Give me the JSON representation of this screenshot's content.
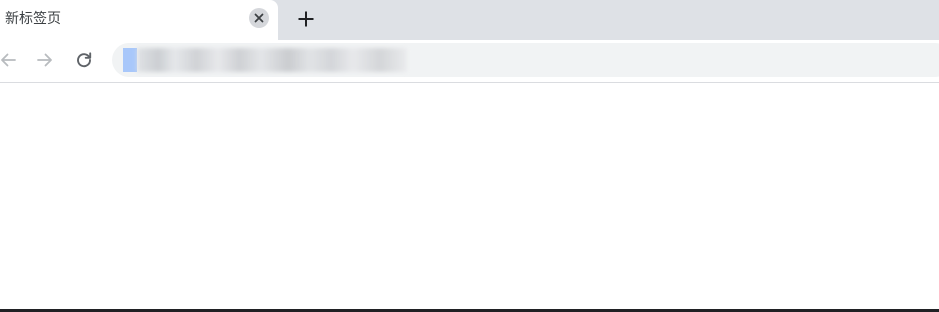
{
  "tab": {
    "title": "新标签页"
  },
  "toolbar": {
    "back_icon": "arrow-left-icon",
    "forward_icon": "arrow-right-icon",
    "reload_icon": "reload-icon",
    "new_tab_icon": "plus-icon",
    "close_icon": "close-icon"
  },
  "omnibox": {
    "url": ""
  },
  "colors": {
    "tabstrip_bg": "#dee1e6",
    "omnibox_bg": "#f1f3f4",
    "selection": "#a8c7fa"
  }
}
